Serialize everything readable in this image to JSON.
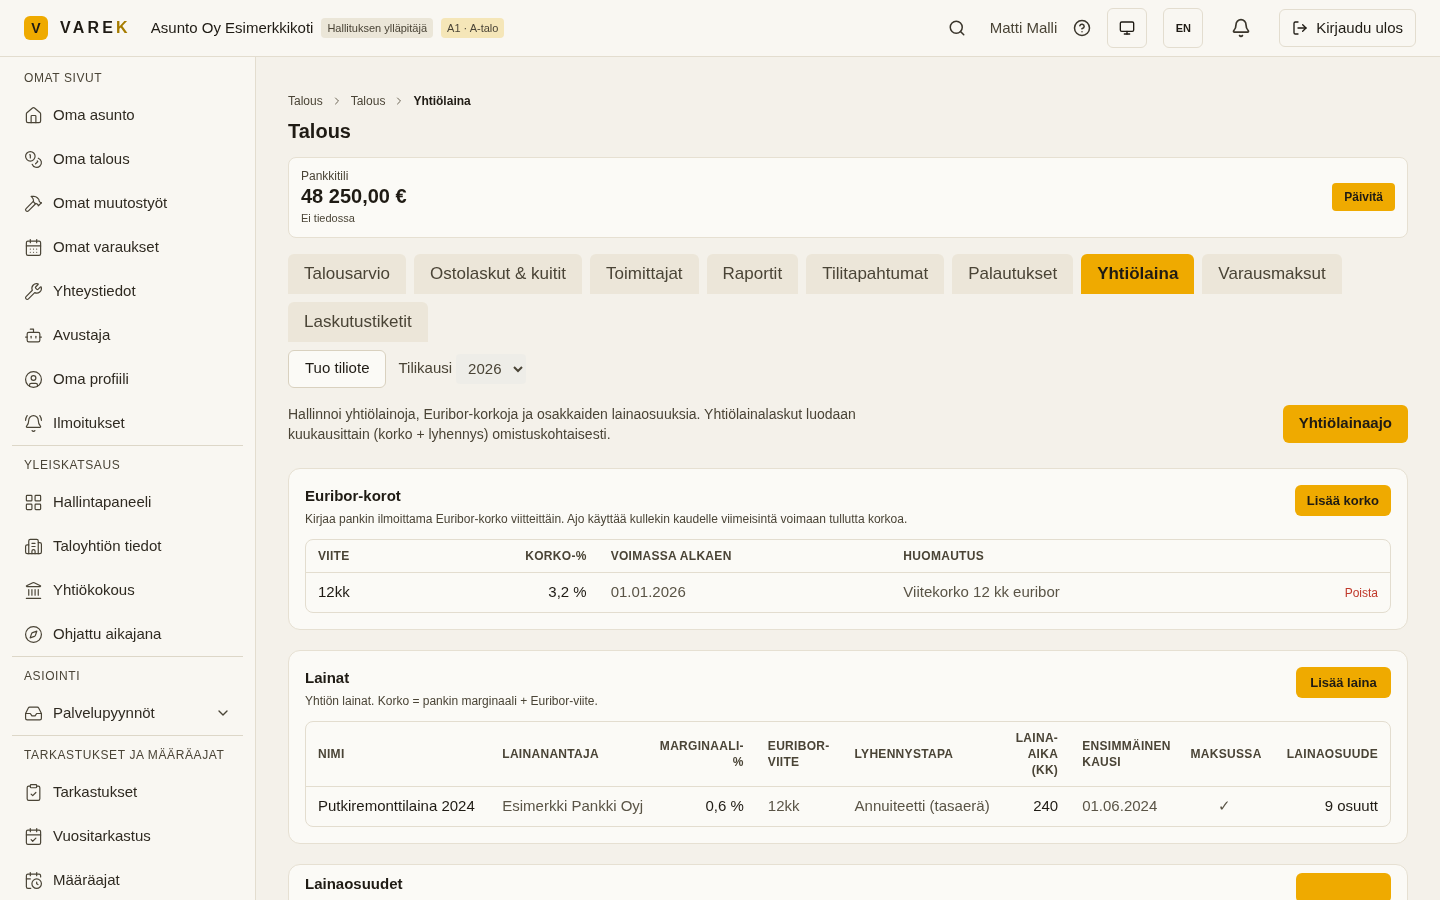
{
  "header": {
    "logo": {
      "mark": "V",
      "name": "VARE",
      "name_accent": "K"
    },
    "company": "Asunto Oy Esimerkkikoti",
    "badges": [
      {
        "text": "Hallituksen ylläpitäjä",
        "color": "#ebe6d8"
      },
      {
        "text": "A1 · A-talo",
        "color": "#f5e6b8"
      }
    ],
    "user": "Matti Malli",
    "language": "EN",
    "logout": "Kirjaudu ulos"
  },
  "sidebar": {
    "sections": [
      {
        "title": "OMAT SIVUT",
        "items": [
          {
            "label": "Oma asunto"
          },
          {
            "label": "Oma talous"
          },
          {
            "label": "Omat muutostyöt"
          },
          {
            "label": "Omat varaukset"
          },
          {
            "label": "Yhteystiedot"
          },
          {
            "label": "Avustaja"
          },
          {
            "label": "Oma profiili"
          },
          {
            "label": "Ilmoitukset"
          }
        ]
      },
      {
        "title": "YLEISKATSAUS",
        "items": [
          {
            "label": "Hallintapaneeli"
          },
          {
            "label": "Taloyhtiön tiedot"
          },
          {
            "label": "Yhtiökokous"
          },
          {
            "label": "Ohjattu aikajana"
          }
        ]
      },
      {
        "title": "ASIOINTI",
        "items": [
          {
            "label": "Palvelupyynnöt",
            "expanded": false
          }
        ]
      },
      {
        "title": "TARKASTUKSET JA MÄÄRÄAJAT",
        "items": [
          {
            "label": "Tarkastukset"
          },
          {
            "label": "Vuositarkastus"
          },
          {
            "label": "Määräajat"
          }
        ]
      }
    ]
  },
  "breadcrumb": [
    "Talous",
    "Talous",
    "Yhtiölaina"
  ],
  "page_title": "Talous",
  "bank": {
    "label": "Pankkitili",
    "amount": "48 250,00 €",
    "note": "Ei tiedossa",
    "button": "Päivitä"
  },
  "tabs": [
    {
      "label": "Talousarvio",
      "selected": false
    },
    {
      "label": "Ostolaskut & kuitit",
      "selected": false
    },
    {
      "label": "Toimittajat",
      "selected": false
    },
    {
      "label": "Raportit",
      "selected": false
    },
    {
      "label": "Tilitapahtumat",
      "selected": false
    },
    {
      "label": "Palautukset",
      "selected": false
    },
    {
      "label": "Yhtiölaina",
      "selected": true
    },
    {
      "label": "Varausmaksut",
      "selected": false
    },
    {
      "label": "Laskutustiketit",
      "selected": false
    }
  ],
  "toolbar": {
    "import_button": "Tuo tiliote",
    "period_label": "Tilikausi",
    "period_value": "2026"
  },
  "intro": "Hallinnoi yhtiölainoja, Euribor-korkoja ja osakkaiden lainaosuuksia. Yhtiölainalaskut luodaan kuukausittain (korko + lyhennys) omistuskohtaisesti.",
  "primary_button": "Yhtiölainaajo",
  "euribor": {
    "title": "Euribor-korot",
    "description": "Kirjaa pankin ilmoittama Euribor-korko viitteittäin. Ajo käyttää kullekin kaudelle viimeisintä voimaan tullutta korkoa.",
    "button": "Lisää korko",
    "columns": [
      {
        "label": "VIITE",
        "kind": "text"
      },
      {
        "label": "KORKO-%",
        "kind": "number"
      },
      {
        "label": "VOIMASSA ALKAEN",
        "kind": "text"
      },
      {
        "label": "HUOMAUTUS",
        "kind": "text"
      },
      {
        "kind": "action"
      }
    ],
    "rows": [
      [
        "12kk",
        "3,2 %",
        "01.01.2026",
        "Viitekorko 12 kk euribor",
        "Poista"
      ]
    ]
  },
  "loans": {
    "title": "Lainat",
    "description": "Yhtiön lainat. Korko = pankin marginaali + Euribor-viite.",
    "button": "Lisää laina",
    "columns": [
      {
        "label": "NIMI",
        "kind": "text"
      },
      {
        "label": "LAINANANTAJA",
        "kind": "text"
      },
      {
        "label": "MARGINAALI-%",
        "kind": "number"
      },
      {
        "label": "EURIBOR-VIITE",
        "kind": "text"
      },
      {
        "label": "LYHENNYSTAPA",
        "kind": "text"
      },
      {
        "label": "LAINA-AIKA (KK)",
        "kind": "number"
      },
      {
        "label": "ENSIMMÄINEN KAUSI",
        "kind": "text"
      },
      {
        "label": "MAKSUSSA",
        "kind": "center"
      },
      {
        "label": "LAINAOSUUDE",
        "kind": "number"
      }
    ],
    "rows": [
      [
        "Putkiremonttilaina 2024",
        "Esimerkki Pankki Oyj",
        "0,6 %",
        "12kk",
        "Annuiteetti (tasaerä)",
        "240",
        "01.06.2024",
        "✓",
        "9 osuutt"
      ]
    ]
  },
  "shares": {
    "title": "Lainaosuudet"
  }
}
